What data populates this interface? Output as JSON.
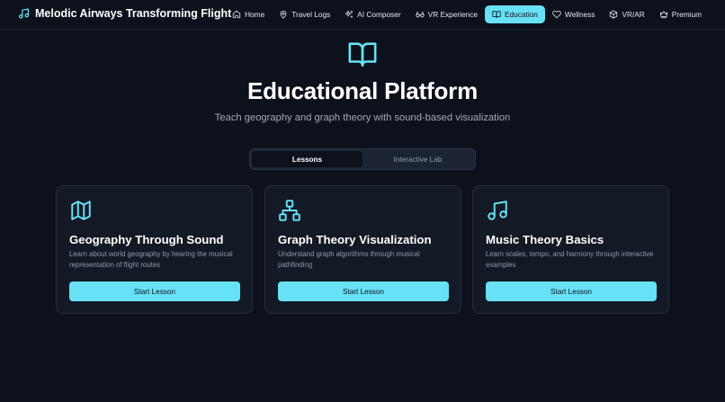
{
  "app": {
    "title": "Melodic Airways Transforming Flight",
    "logo_icon": "music-note-icon"
  },
  "nav": {
    "items": [
      {
        "label": "Home",
        "icon": "home-icon",
        "active": false
      },
      {
        "label": "Travel Logs",
        "icon": "map-pin-icon",
        "active": false
      },
      {
        "label": "AI Composer",
        "icon": "sparkles-icon",
        "active": false
      },
      {
        "label": "VR Experience",
        "icon": "vr-glasses-icon",
        "active": false
      },
      {
        "label": "Education",
        "icon": "book-open-icon",
        "active": true
      },
      {
        "label": "Wellness",
        "icon": "heart-icon",
        "active": false
      },
      {
        "label": "VR/AR",
        "icon": "cube-icon",
        "active": false
      },
      {
        "label": "Premium",
        "icon": "crown-icon",
        "active": false
      }
    ]
  },
  "hero": {
    "icon": "book-open-icon",
    "title": "Educational Platform",
    "subtitle": "Teach geography and graph theory with sound-based visualization"
  },
  "tabs": [
    {
      "label": "Lessons",
      "active": true
    },
    {
      "label": "Interactive Lab",
      "active": false
    }
  ],
  "cards": [
    {
      "icon": "map-icon",
      "title": "Geography Through Sound",
      "description": "Learn about world geography by hearing the musical representation of flight routes",
      "button": "Start Lesson"
    },
    {
      "icon": "network-icon",
      "title": "Graph Theory Visualization",
      "description": "Understand graph algorithms through musical pathfinding",
      "button": "Start Lesson"
    },
    {
      "icon": "music-note-icon",
      "title": "Music Theory Basics",
      "description": "Learn scales, tempo, and harmony through interactive examples",
      "button": "Start Lesson"
    }
  ],
  "colors": {
    "background": "#0c111c",
    "accent": "#67e1f5",
    "card": "#131a26",
    "muted_text": "#8f98a8"
  }
}
